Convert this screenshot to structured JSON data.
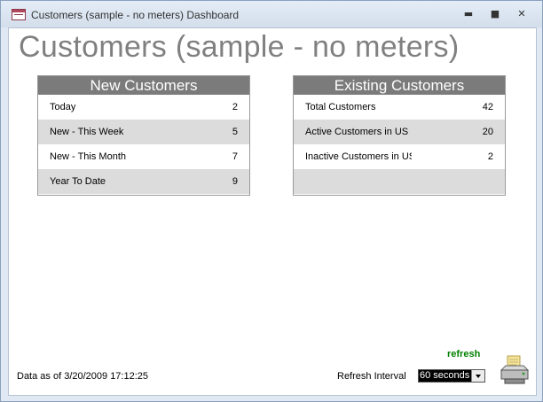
{
  "window": {
    "title": "Customers (sample - no meters) Dashboard",
    "controls": {
      "minimize": "▬",
      "maximize": "■",
      "close": "✕"
    }
  },
  "page": {
    "title": "Customers (sample - no meters)"
  },
  "new_customers": {
    "header": "New Customers",
    "rows": [
      {
        "label": "Today",
        "value": "2"
      },
      {
        "label": "New - This Week",
        "value": "5"
      },
      {
        "label": "New - This Month",
        "value": "7"
      },
      {
        "label": "Year To Date",
        "value": "9"
      }
    ]
  },
  "existing_customers": {
    "header": "Existing Customers",
    "rows": [
      {
        "label": "Total Customers",
        "value": "42"
      },
      {
        "label": "Active Customers in US",
        "value": "20"
      },
      {
        "label": "Inactive Customers in US",
        "value": "2"
      },
      {
        "label": "",
        "value": ""
      }
    ]
  },
  "footer": {
    "data_as_of": "Data as of 3/20/2009 17:12:25",
    "refresh_link": "refresh",
    "refresh_interval_label": "Refresh Interval",
    "refresh_interval_value": "60 seconds"
  },
  "icons": {
    "app": "form-icon",
    "print": "printer-icon"
  },
  "colors": {
    "title_gray": "#808080",
    "header_gray": "#7b7b7b",
    "row_shade": "#dcdcdc",
    "refresh_green": "#008000"
  }
}
